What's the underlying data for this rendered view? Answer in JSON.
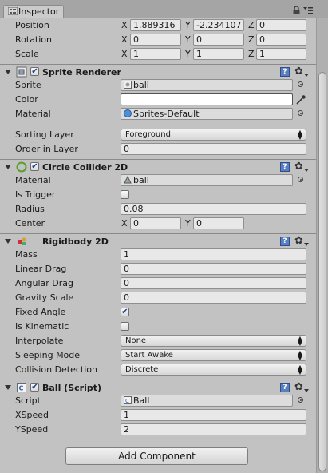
{
  "tab": {
    "title": "Inspector"
  },
  "transform": {
    "position": {
      "label": "Position",
      "x": "1.889316",
      "y": "-2.234107",
      "z": "0"
    },
    "rotation": {
      "label": "Rotation",
      "x": "0",
      "y": "0",
      "z": "0"
    },
    "scale": {
      "label": "Scale",
      "x": "1",
      "y": "1",
      "z": "1"
    },
    "axes": {
      "x": "X",
      "y": "Y",
      "z": "Z"
    }
  },
  "sprite_renderer": {
    "title": "Sprite Renderer",
    "enabled": true,
    "sprite": {
      "label": "Sprite",
      "value": "ball"
    },
    "color": {
      "label": "Color",
      "value": "#ffffff"
    },
    "material": {
      "label": "Material",
      "value": "Sprites-Default"
    },
    "sorting_layer": {
      "label": "Sorting Layer",
      "value": "Foreground"
    },
    "order_in_layer": {
      "label": "Order in Layer",
      "value": "0"
    }
  },
  "circle_collider": {
    "title": "Circle Collider 2D",
    "enabled": true,
    "material": {
      "label": "Material",
      "value": "ball"
    },
    "is_trigger": {
      "label": "Is Trigger",
      "checked": false
    },
    "radius": {
      "label": "Radius",
      "value": "0.08"
    },
    "center": {
      "label": "Center",
      "x": "0",
      "y": "0"
    }
  },
  "rigidbody": {
    "title": "Rigidbody 2D",
    "mass": {
      "label": "Mass",
      "value": "1"
    },
    "linear_drag": {
      "label": "Linear Drag",
      "value": "0"
    },
    "angular_drag": {
      "label": "Angular Drag",
      "value": "0"
    },
    "gravity_scale": {
      "label": "Gravity Scale",
      "value": "0"
    },
    "fixed_angle": {
      "label": "Fixed Angle",
      "checked": true
    },
    "is_kinematic": {
      "label": "Is Kinematic",
      "checked": false
    },
    "interpolate": {
      "label": "Interpolate",
      "value": "None"
    },
    "sleeping_mode": {
      "label": "Sleeping Mode",
      "value": "Start Awake"
    },
    "collision_detection": {
      "label": "Collision Detection",
      "value": "Discrete"
    }
  },
  "ball_script": {
    "title": "Ball (Script)",
    "enabled": true,
    "script": {
      "label": "Script",
      "value": "Ball"
    },
    "xspeed": {
      "label": "XSpeed",
      "value": "1"
    },
    "yspeed": {
      "label": "YSpeed",
      "value": "2"
    }
  },
  "add_component": {
    "label": "Add Component"
  },
  "icons": {
    "tab": "inspector-icon",
    "lock": "lock-icon",
    "menu": "context-menu-icon",
    "fold": "foldout-arrow-icon",
    "help": "help-book-icon",
    "gear": "gear-icon",
    "target": "object-picker-icon"
  },
  "colors": {
    "background": "#c2c2c2",
    "field": "#e8e8e8",
    "help_icon": "#5a7fc0"
  }
}
